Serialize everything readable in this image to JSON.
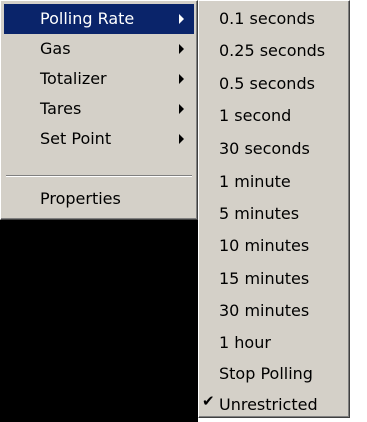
{
  "main_menu": {
    "items": [
      {
        "label": "Polling Rate"
      },
      {
        "label": "Gas"
      },
      {
        "label": "Totalizer"
      },
      {
        "label": "Tares"
      },
      {
        "label": "Set Point"
      },
      {
        "label": "Properties"
      }
    ]
  },
  "sub_menu": {
    "items": [
      {
        "label": "0.1 seconds"
      },
      {
        "label": "0.25 seconds"
      },
      {
        "label": "0.5 seconds"
      },
      {
        "label": "1 second"
      },
      {
        "label": "30 seconds"
      },
      {
        "label": "1 minute"
      },
      {
        "label": "5 minutes"
      },
      {
        "label": "10 minutes"
      },
      {
        "label": "15 minutes"
      },
      {
        "label": "30 minutes"
      },
      {
        "label": "1 hour"
      },
      {
        "label": "Stop Polling"
      },
      {
        "label": "Unrestricted",
        "checked": true
      }
    ],
    "check_glyph": "✔"
  },
  "colors": {
    "menu_bg": "#d4d0c8",
    "highlight_bg": "#0a246a",
    "highlight_text": "#ffffff"
  }
}
